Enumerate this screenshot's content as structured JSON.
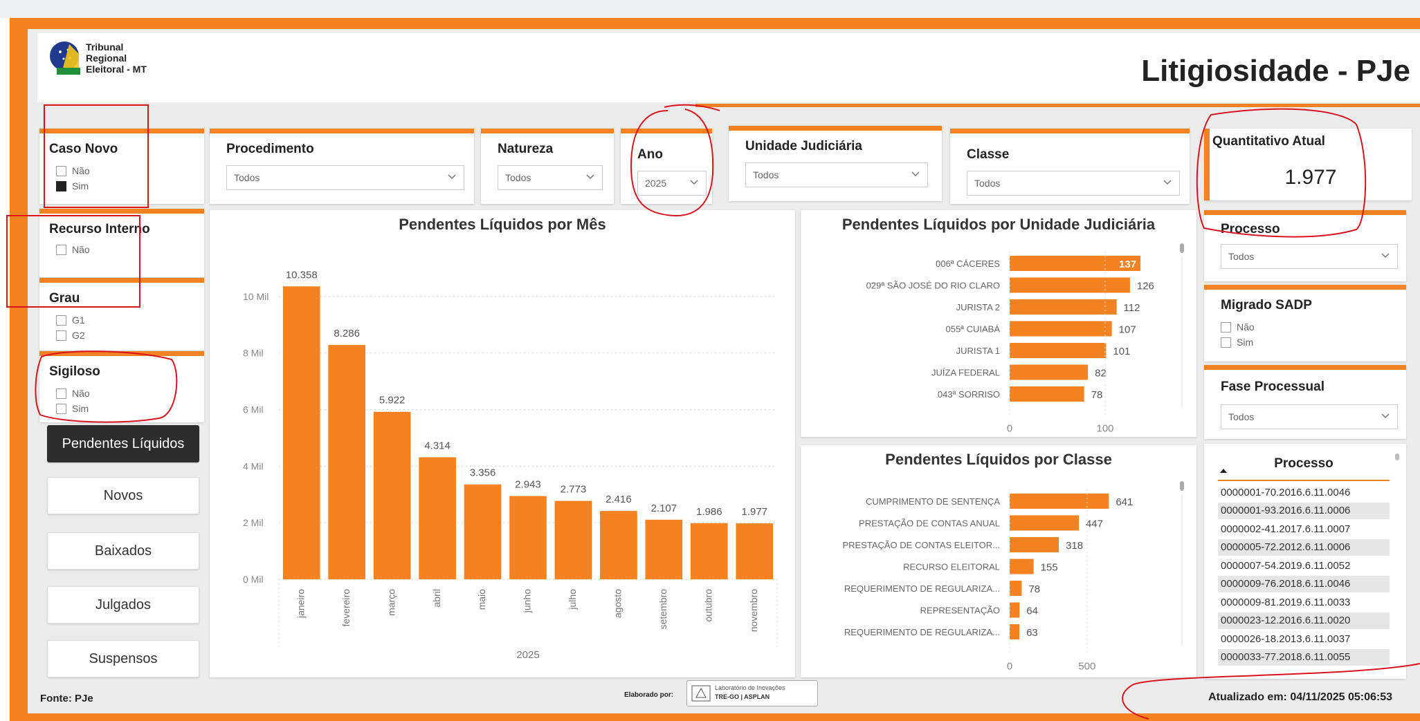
{
  "header": {
    "logo_lines": [
      "Tribunal",
      "Regional",
      "Eleitoral - MT"
    ],
    "title": "Litigiosidade - PJe"
  },
  "slicers": {
    "caso_novo": {
      "title": "Caso Novo",
      "options": [
        {
          "label": "Não",
          "checked": false
        },
        {
          "label": "Sim",
          "checked": true
        }
      ]
    },
    "recurso_interno": {
      "title": "Recurso Interno",
      "options": [
        {
          "label": "Não",
          "checked": false
        }
      ]
    },
    "grau": {
      "title": "Grau",
      "options": [
        {
          "label": "G1",
          "checked": false
        },
        {
          "label": "G2",
          "checked": false
        }
      ]
    },
    "sigiloso": {
      "title": "Sigiloso",
      "options": [
        {
          "label": "Não",
          "checked": false
        },
        {
          "label": "Sim",
          "checked": false
        }
      ]
    },
    "migrado_sadp": {
      "title": "Migrado SADP",
      "options": [
        {
          "label": "Não",
          "checked": false
        },
        {
          "label": "Sim",
          "checked": false
        }
      ]
    }
  },
  "dropdowns": {
    "procedimento": {
      "title": "Procedimento",
      "value": "Todos"
    },
    "natureza": {
      "title": "Natureza",
      "value": "Todos"
    },
    "ano": {
      "title": "Ano",
      "value": "2025"
    },
    "unidade": {
      "title": "Unidade Judiciária",
      "value": "Todos"
    },
    "classe": {
      "title": "Classe",
      "value": "Todos"
    },
    "processo": {
      "title": "Processo",
      "value": "Todos"
    },
    "fase": {
      "title": "Fase Processual",
      "value": "Todos"
    }
  },
  "kpi": {
    "label": "Quantitativo Atual",
    "value": "1.977"
  },
  "nav_buttons": [
    {
      "label": "Pendentes Líquidos",
      "active": true
    },
    {
      "label": "Novos",
      "active": false
    },
    {
      "label": "Baixados",
      "active": false
    },
    {
      "label": "Julgados",
      "active": false
    },
    {
      "label": "Suspensos",
      "active": false
    }
  ],
  "chart_data": [
    {
      "type": "bar",
      "title": "Pendentes Líquidos por Mês",
      "xlabel": "2025",
      "categories": [
        "janeiro",
        "fevereiro",
        "março",
        "abril",
        "maio",
        "junho",
        "julho",
        "agosto",
        "setembro",
        "outubro",
        "novembro"
      ],
      "values": [
        10358,
        8286,
        5922,
        4314,
        3356,
        2943,
        2773,
        2416,
        2107,
        1986,
        1977
      ],
      "value_labels": [
        "10.358",
        "8.286",
        "5.922",
        "4.314",
        "3.356",
        "2.943",
        "2.773",
        "2.416",
        "2.107",
        "1.986",
        "1.977"
      ],
      "y_ticks": [
        "0 Mil",
        "2 Mil",
        "4 Mil",
        "6 Mil",
        "8 Mil",
        "10 Mil"
      ],
      "ylim": [
        0,
        11000
      ],
      "color": "#f58220"
    },
    {
      "type": "bar",
      "orientation": "horizontal",
      "title": "Pendentes Líquidos por Unidade Judiciária",
      "categories": [
        "006ª CÁCERES",
        "029ª SÃO JOSÉ DO RIO CLARO",
        "JURISTA 2",
        "055ª CUIABÁ",
        "JURISTA 1",
        "JUÍZA FEDERAL",
        "043ª SORRISO"
      ],
      "values": [
        137,
        126,
        112,
        107,
        101,
        82,
        78
      ],
      "x_ticks": [
        "0",
        "100"
      ],
      "xlim": [
        0,
        170
      ],
      "color": "#f58220"
    },
    {
      "type": "bar",
      "orientation": "horizontal",
      "title": "Pendentes Líquidos por Classe",
      "categories": [
        "CUMPRIMENTO DE SENTENÇA",
        "PRESTAÇÃO DE CONTAS ANUAL",
        "PRESTAÇÃO DE CONTAS ELEITOR...",
        "RECURSO ELEITORAL",
        "REQUERIMENTO DE REGULARIZA...",
        "REPRESENTAÇÃO",
        "REQUERIMENTO DE REGULARIZA..."
      ],
      "values": [
        641,
        447,
        318,
        155,
        78,
        64,
        63
      ],
      "x_ticks": [
        "0",
        "500"
      ],
      "xlim": [
        0,
        720
      ],
      "color": "#f58220"
    }
  ],
  "process_table": {
    "header": "Processo",
    "rows": [
      "0000001-70.2016.6.11.0046",
      "0000001-93.2016.6.11.0006",
      "0000002-41.2017.6.11.0007",
      "0000005-72.2012.6.11.0006",
      "0000007-54.2019.6.11.0052",
      "0000009-76.2018.6.11.0046",
      "0000009-81.2019.6.11.0033",
      "0000023-12.2016.6.11.0020",
      "0000026-18.2013.6.11.0037",
      "0000033-77.2018.6.11.0055"
    ]
  },
  "footer": {
    "source": "Fonte: PJe",
    "credit_label": "Elaborado por:",
    "credit_lab": "Laboratório de Inovações",
    "credit_org": "TRE-GO | ASPLAN",
    "updated": "Atualizado em: 04/11/2025 05:06:53"
  }
}
